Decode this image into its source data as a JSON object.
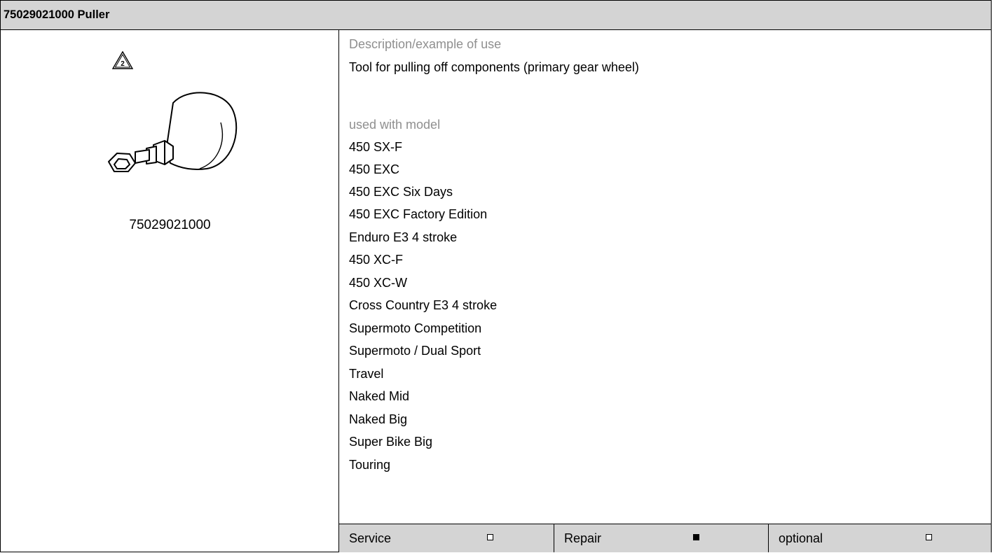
{
  "header": {
    "title": "75029021000 Puller"
  },
  "tool": {
    "warning_number": "2",
    "part_number": "75029021000",
    "image_icon": "puller-tool-drawing"
  },
  "description": {
    "label": "Description/example of use",
    "text": "Tool for pulling off components (primary gear wheel)"
  },
  "models": {
    "label": "used with model",
    "items": [
      "450 SX-F",
      "450 EXC",
      "450 EXC Six Days",
      "450 EXC Factory Edition",
      "Enduro E3 4 stroke",
      "450 XC-F",
      "450 XC-W",
      "Cross Country E3 4 stroke",
      "Supermoto Competition",
      "Supermoto / Dual Sport",
      "Travel",
      "Naked Mid",
      "Naked Big",
      "Super Bike Big",
      "Touring"
    ]
  },
  "footer": {
    "service": {
      "label": "Service",
      "checked": false
    },
    "repair": {
      "label": "Repair",
      "checked": true
    },
    "optional": {
      "label": "optional",
      "checked": false
    }
  }
}
